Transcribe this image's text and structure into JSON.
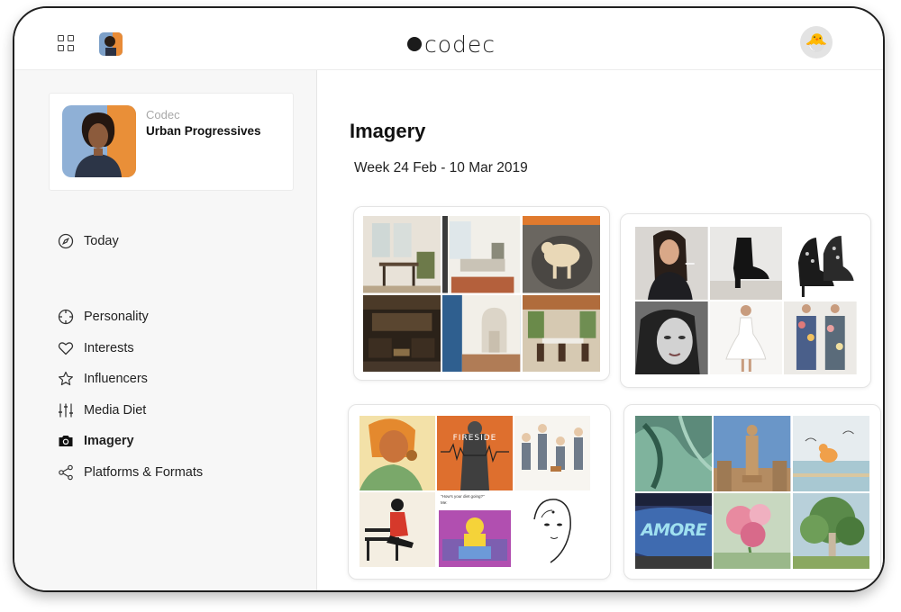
{
  "app": {
    "brand": "codec"
  },
  "profile": {
    "org": "Codec",
    "segment": "Urban Progressives"
  },
  "nav": {
    "today": "Today",
    "items": [
      "Personality",
      "Interests",
      "Influencers",
      "Media Diet",
      "Imagery",
      "Platforms & Formats"
    ],
    "active": "Imagery"
  },
  "main": {
    "title": "Imagery",
    "date_range": "Week 24 Feb - 10 Mar 2019",
    "cards": [
      {
        "theme": "interiors",
        "tiles": [
          "dining-room",
          "living-room",
          "dog-on-chair",
          "dark-lounge",
          "white-doorway",
          "patio-dining"
        ]
      },
      {
        "theme": "fashion",
        "tiles": [
          "woman-smoking",
          "black-ankle-boot",
          "studded-heels",
          "portrait-bw",
          "white-dress",
          "floral-outfit"
        ]
      },
      {
        "theme": "illustration",
        "tiles": [
          "comic-girl",
          "fireside-poster",
          "cartoon-family",
          "reading-on-bench",
          "cartoon-couch",
          "ink-portrait"
        ],
        "text": {
          "fireside": "FIRESIDE",
          "caption": "\"How's your diet going?\"",
          "reply": "Me:"
        }
      },
      {
        "theme": "art",
        "tiles": [
          "green-abstract",
          "statue",
          "watercolor-birds",
          "graffiti-wall",
          "flower-painting",
          "tree-painting"
        ],
        "text": {
          "graffiti": "AMORE"
        }
      }
    ]
  },
  "colors": {
    "accent": "#111111",
    "sidebar_bg": "#f7f7f7",
    "border": "#e4e4e4"
  }
}
